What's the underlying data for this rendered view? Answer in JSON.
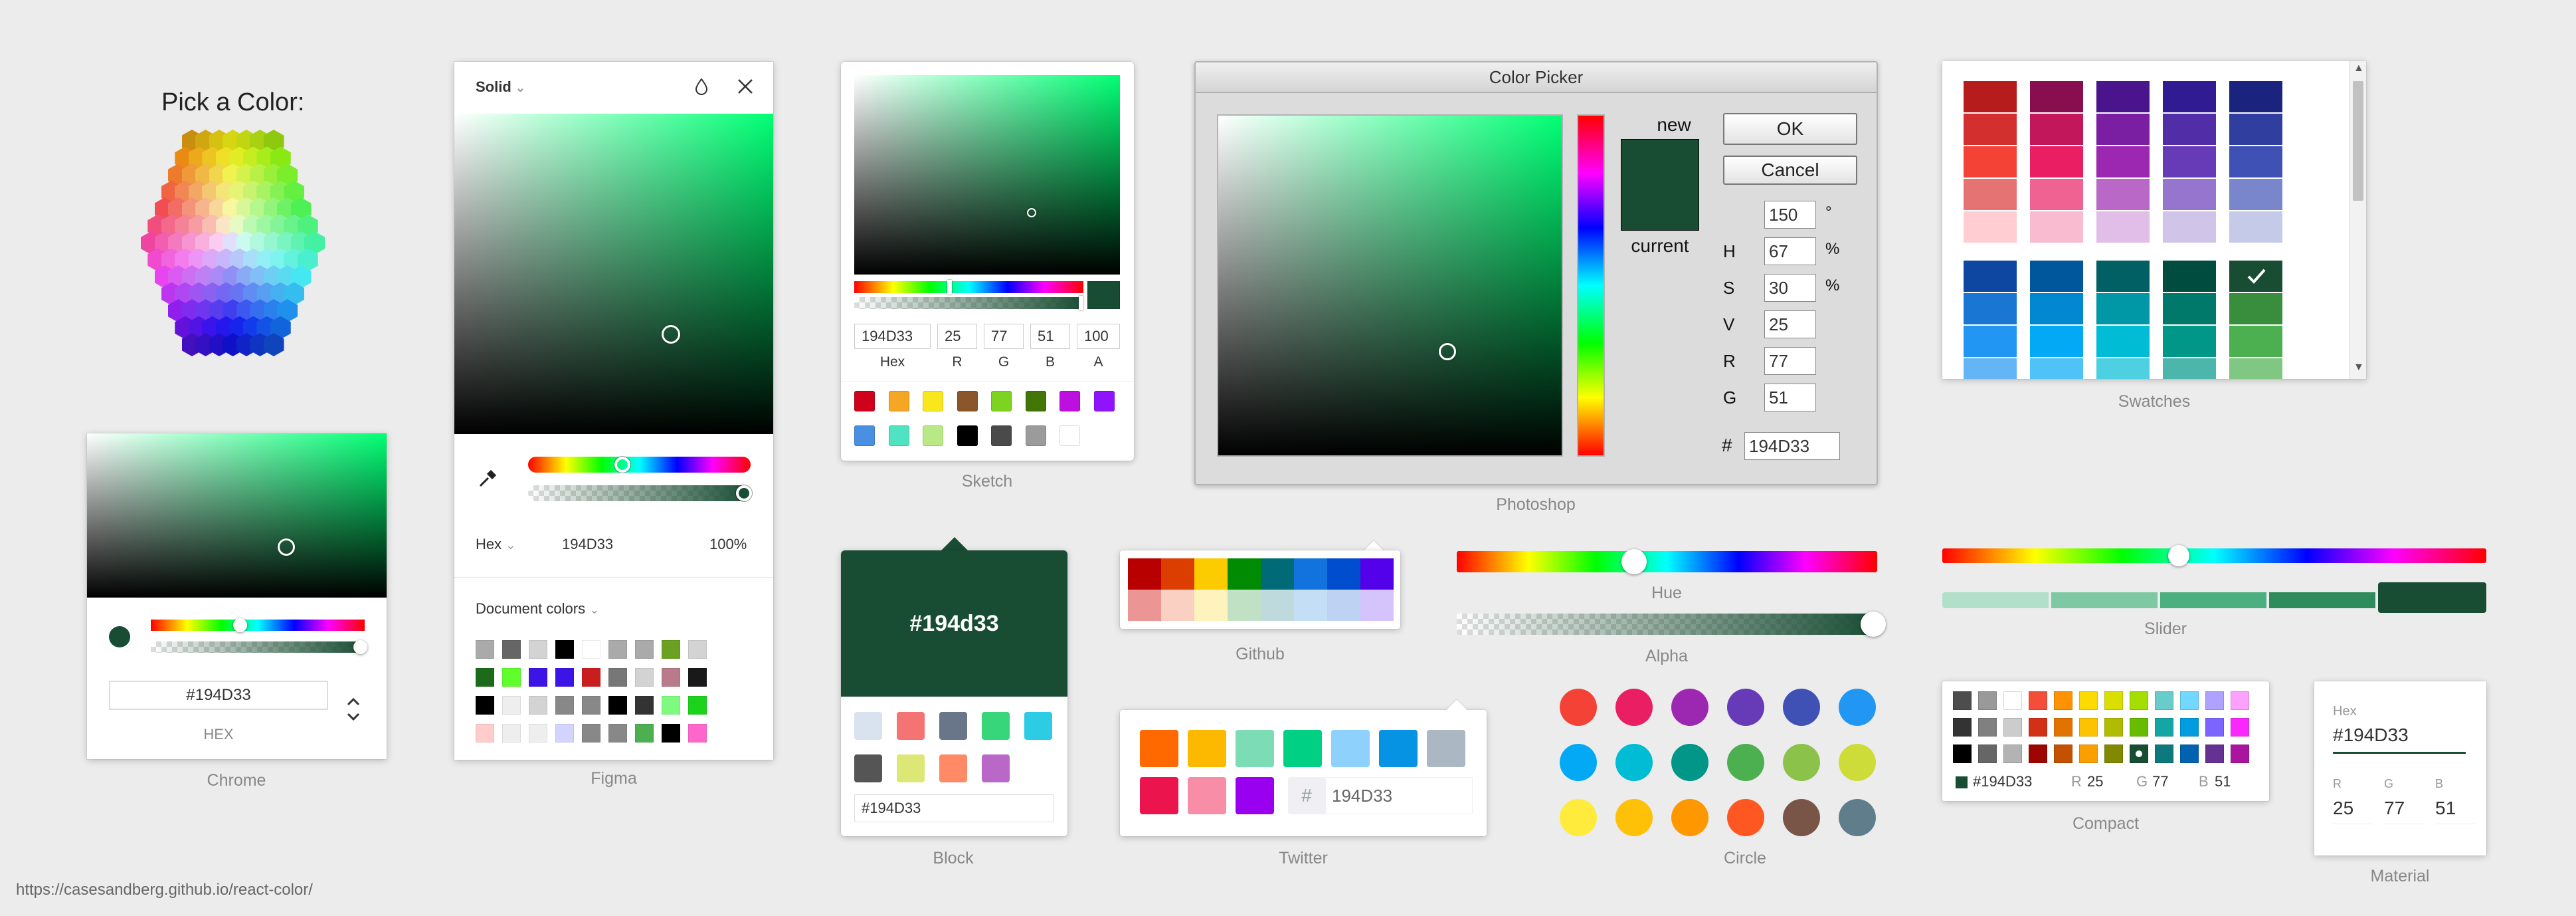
{
  "colors": {
    "selected": "#194D33",
    "bg": "#ececec"
  },
  "footer_url": "https://casesandberg.github.io/react-color/",
  "hexagon": {
    "title": "Pick a Color:"
  },
  "chrome": {
    "caption": "Chrome",
    "hex_value": "#194D33",
    "hex_label": "HEX",
    "hue_value": 0.41
  },
  "figma": {
    "caption": "Figma",
    "mode": "Solid",
    "format": "Hex",
    "hex": "194D33",
    "opacity": "100%",
    "doc_colors_label": "Document colors",
    "swatches": [
      "#aaaaaa",
      "#666666",
      "#d3d3d3",
      "#000000",
      "#ffffff",
      "#aaaaaa",
      "#aaaaaa",
      "#6aa120",
      "#d3d3d3",
      "#1b6b1b",
      "#5eff2a",
      "#3c14e6",
      "#3c14e6",
      "#c91e1e",
      "#777777",
      "#d3d3d3",
      "#b87a8c",
      "#191919",
      "#000000",
      "#eeeeee",
      "#d3d3d3",
      "#888888",
      "#888888",
      "#000000",
      "#333333",
      "#7efb7e",
      "#1ad31a",
      "#ffcccc",
      "#eeeeee",
      "#eeeeee",
      "#d3d3ff",
      "#888888",
      "#888888",
      "#4caf50",
      "#000000",
      "#ff66cc"
    ]
  },
  "sketch": {
    "caption": "Sketch",
    "hex": "194D33",
    "r": "25",
    "g": "77",
    "b": "51",
    "a": "100",
    "labels": [
      "Hex",
      "R",
      "G",
      "B",
      "A"
    ],
    "presets": [
      "#D0021B",
      "#F5A623",
      "#F8E71C",
      "#8B572A",
      "#7ED321",
      "#417505",
      "#BD10E0",
      "#9013FE",
      "#4A90E2",
      "#50E3C2",
      "#B8E986",
      "#000000",
      "#4A4A4A",
      "#9B9B9B",
      "#FFFFFF"
    ]
  },
  "photoshop": {
    "caption": "Photoshop",
    "title": "Color Picker",
    "new_label": "new",
    "current_label": "current",
    "ok": "OK",
    "cancel": "Cancel",
    "fields": [
      {
        "label": "",
        "value": "150",
        "unit": "°"
      },
      {
        "label": "H",
        "value": "67",
        "unit": "%"
      },
      {
        "label": "S",
        "value": "30",
        "unit": "%"
      },
      {
        "label": "V",
        "value": "25",
        "unit": ""
      },
      {
        "label": "R",
        "value": "77",
        "unit": ""
      },
      {
        "label": "G",
        "value": "51",
        "unit": ""
      }
    ],
    "hash_label": "#",
    "hex": "194D33"
  },
  "swatches": {
    "caption": "Swatches",
    "groups": [
      [
        "#b71c1c",
        "#d32f2f",
        "#f44336",
        "#e57373",
        "#ffcdd2"
      ],
      [
        "#880e4f",
        "#c2185b",
        "#e91e63",
        "#f06292",
        "#f8bbd0"
      ],
      [
        "#4a148c",
        "#7b1fa2",
        "#9c27b0",
        "#ba68c8",
        "#e1bee7"
      ],
      [
        "#311b92",
        "#512da8",
        "#673ab7",
        "#9575cd",
        "#d1c4e9"
      ],
      [
        "#1a237e",
        "#303f9f",
        "#3f51b5",
        "#7986cb",
        "#c5cae9"
      ]
    ],
    "groups2": [
      [
        "#0d47a1",
        "#1976d2",
        "#2196f3",
        "#64b5f6"
      ],
      [
        "#01579b",
        "#0288d1",
        "#03a9f4",
        "#4fc3f7"
      ],
      [
        "#006064",
        "#0097a7",
        "#00bcd4",
        "#4dd0e1"
      ],
      [
        "#004d40",
        "#00796b",
        "#009688",
        "#4db6ac"
      ],
      [
        "#194d33",
        "#388e3c",
        "#4caf50",
        "#81c784"
      ]
    ]
  },
  "block": {
    "caption": "Block",
    "hex_display": "#194d33",
    "input": "#194D33",
    "colors": [
      "#D9E3F0",
      "#F47373",
      "#697689",
      "#37D67A",
      "#2CCCE4",
      "#555555",
      "#dce775",
      "#ff8a65",
      "#ba68c8"
    ]
  },
  "github": {
    "caption": "Github",
    "colors": [
      "#B80000",
      "#DB3E00",
      "#FCCB00",
      "#008B02",
      "#006B76",
      "#1273DE",
      "#004DCF",
      "#5300EB",
      "#EB9694",
      "#FAD0C3",
      "#FEF3BD",
      "#C1E1C5",
      "#BEDADC",
      "#C4DEF6",
      "#BED3F3",
      "#D4C4FB"
    ]
  },
  "twitter": {
    "caption": "Twitter",
    "hash": "#",
    "hex": "194D33",
    "colors": [
      "#FF6900",
      "#FCB900",
      "#7BDCB5",
      "#00D084",
      "#8ED1FC",
      "#0693E3",
      "#ABB8C3",
      "#EB144C",
      "#F78DA7",
      "#9900EF"
    ]
  },
  "hue_alpha": {
    "hue_caption": "Hue",
    "alpha_caption": "Alpha",
    "hue_value": 0.42
  },
  "slider": {
    "caption": "Slider",
    "hue_value": 0.55,
    "shades": [
      "#b2dfca",
      "#7ec8a4",
      "#4caf7f",
      "#2e8b5c",
      "#194d33"
    ]
  },
  "circle": {
    "caption": "Circle",
    "colors": [
      "#f44336",
      "#e91e63",
      "#9c27b0",
      "#673ab7",
      "#3f51b5",
      "#2196f3",
      "#03a9f4",
      "#00bcd4",
      "#009688",
      "#4caf50",
      "#8bc34a",
      "#cddc39",
      "#ffeb3b",
      "#ffc107",
      "#ff9800",
      "#ff5722",
      "#795548",
      "#607d8b"
    ]
  },
  "compact": {
    "caption": "Compact",
    "hex": "#194D33",
    "r_label": "R",
    "r": "25",
    "g_label": "G",
    "g": "77",
    "b_label": "B",
    "b": "51",
    "colors": [
      "#4D4D4D",
      "#999999",
      "#FFFFFF",
      "#F44E3B",
      "#FE9200",
      "#FCDC00",
      "#DBDF00",
      "#A4DD00",
      "#68CCCA",
      "#73D8FF",
      "#AEA1FF",
      "#FDA1FF",
      "#333333",
      "#808080",
      "#CCCCCC",
      "#D33115",
      "#E27300",
      "#FCC400",
      "#B0BC00",
      "#68BC00",
      "#16A5A5",
      "#009CE0",
      "#7B64FF",
      "#FA28FF",
      "#000000",
      "#666666",
      "#B3B3B3",
      "#9F0500",
      "#C45100",
      "#FB9E00",
      "#808900",
      "#194D33",
      "#0C797D",
      "#0062B1",
      "#653294",
      "#AB149E"
    ]
  },
  "material": {
    "caption": "Material",
    "hex_label": "Hex",
    "hex": "#194D33",
    "r_label": "R",
    "g_label": "G",
    "b_label": "B",
    "r": "25",
    "g": "77",
    "b": "51"
  }
}
